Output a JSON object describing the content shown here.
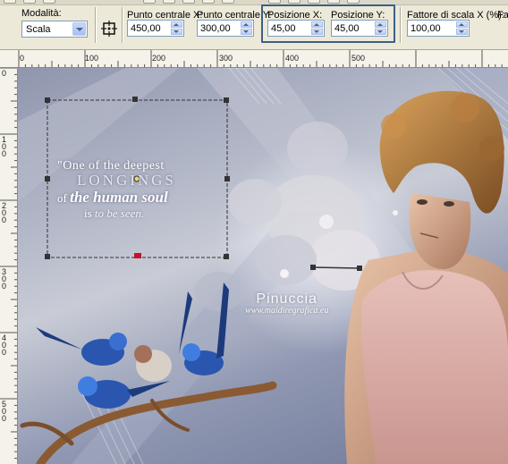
{
  "toolbar": {
    "mode": {
      "label": "Modalità:",
      "value": "Scala"
    },
    "center_x": {
      "label": "Punto centrale X:",
      "value": "450,00"
    },
    "center_y": {
      "label": "Punto centrale Y:",
      "value": "300,00"
    },
    "position_x": {
      "label": "Posizione X:",
      "value": "45,00"
    },
    "position_y": {
      "label": "Posizione Y:",
      "value": "45,00"
    },
    "scale_x": {
      "label": "Fattore di scala X (%):",
      "value": "100,00"
    },
    "extra_label": "Fa",
    "highlight_color": "#3c5f86"
  },
  "ruler": {
    "top_ticks": [
      "0",
      "100",
      "200",
      "300",
      "400",
      "500"
    ],
    "left_ticks": [
      "0",
      "1 0 0",
      "2 0 0",
      "3 0 0",
      "4 0 0",
      "5 0 0"
    ]
  },
  "canvas": {
    "quote": {
      "line1": "\"One of the deepest",
      "line2": "LONGINGS",
      "line3_prefix": "of",
      "line3_bold": "the human soul",
      "line4_prefix": "is",
      "line4_italic": "to be seen."
    },
    "watermark": {
      "name": "Pinuccia",
      "url": "www.maidiregrafica.eu"
    }
  },
  "colors": {
    "toolbar_bg": "#ece9d8",
    "input_border": "#7f9db9",
    "canvas_bluegrey": "#8f96ad",
    "dress_pink": "#d9a9a4"
  }
}
